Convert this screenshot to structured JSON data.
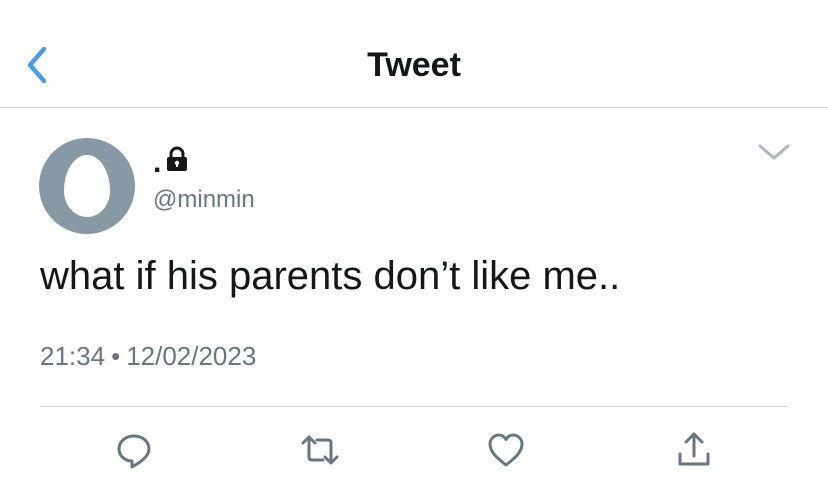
{
  "header": {
    "title": "Tweet",
    "back_icon": "chevron-left-icon",
    "accent_color": "#4a9ce8"
  },
  "tweet": {
    "display_name": ".",
    "protected_icon": "lock-icon",
    "handle": "@minmin",
    "text": "what if his parents don’t like me..",
    "time": "21:34",
    "separator": "•",
    "date": "12/02/2023",
    "avatar": "default-egg-avatar",
    "more_icon": "chevron-down-icon"
  },
  "actions": [
    {
      "name": "reply",
      "icon": "reply-icon"
    },
    {
      "name": "retweet",
      "icon": "retweet-icon"
    },
    {
      "name": "like",
      "icon": "heart-icon"
    },
    {
      "name": "share",
      "icon": "share-icon"
    }
  ],
  "colors": {
    "text": "#14171a",
    "secondary": "#657786",
    "icon": "#657786",
    "divider": "#cfd3d7"
  }
}
